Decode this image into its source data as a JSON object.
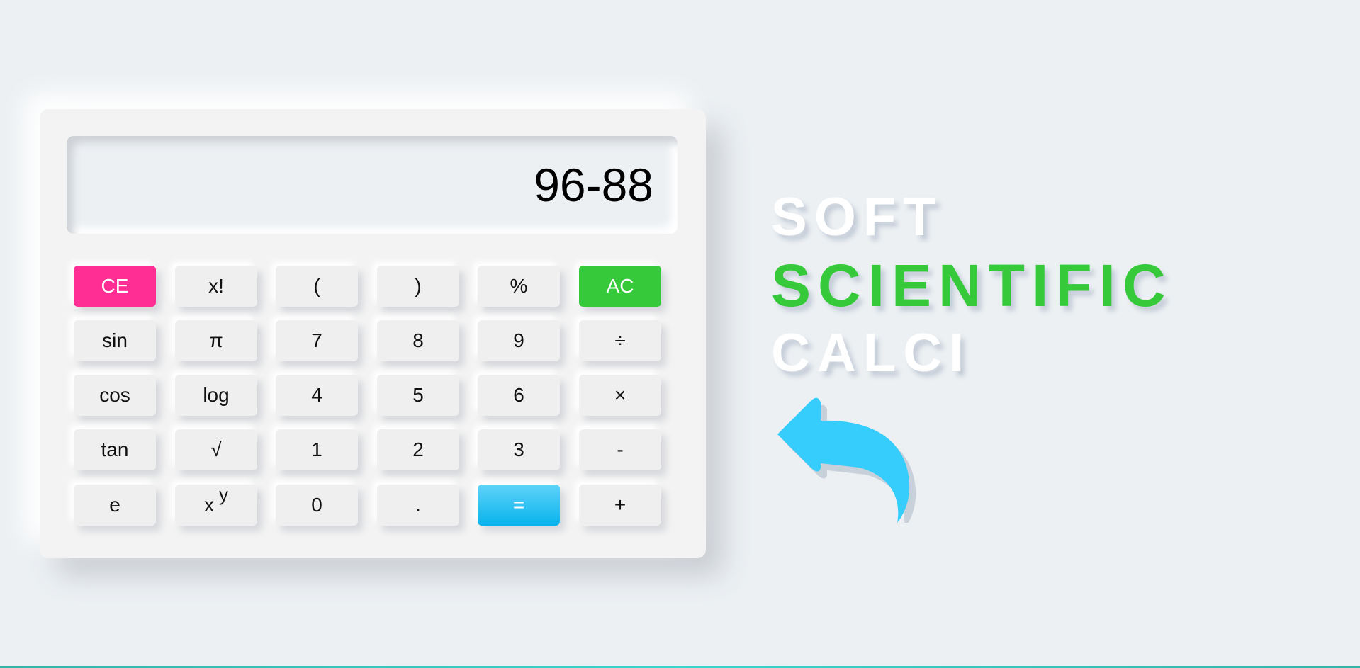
{
  "display": {
    "value": "96-88"
  },
  "keys": {
    "ce": "CE",
    "factorial": "x!",
    "open_paren": "(",
    "close_paren": ")",
    "percent": "%",
    "ac": "AC",
    "sin": "sin",
    "pi": "π",
    "seven": "7",
    "eight": "8",
    "nine": "9",
    "divide": "÷",
    "cos": "cos",
    "log": "log",
    "four": "4",
    "five": "5",
    "six": "6",
    "multiply": "×",
    "tan": "tan",
    "sqrt": "√",
    "one": "1",
    "two": "2",
    "three": "3",
    "minus": "-",
    "e": "e",
    "power_base": "x",
    "power_exp": "y",
    "zero": "0",
    "dot": ".",
    "equals": "=",
    "plus": "+"
  },
  "hero": {
    "line1": "SOFT",
    "line2": "SCIENTIFIC",
    "line3": "CALCI"
  },
  "icons": {
    "back_arrow": "back-arrow-icon"
  },
  "colors": {
    "background": "#ecf0f3",
    "ce": "#ff2e94",
    "ac": "#36c93a",
    "equals": "#07b3ec",
    "accent_green": "#36c93a",
    "arrow": "#36cdfd"
  }
}
